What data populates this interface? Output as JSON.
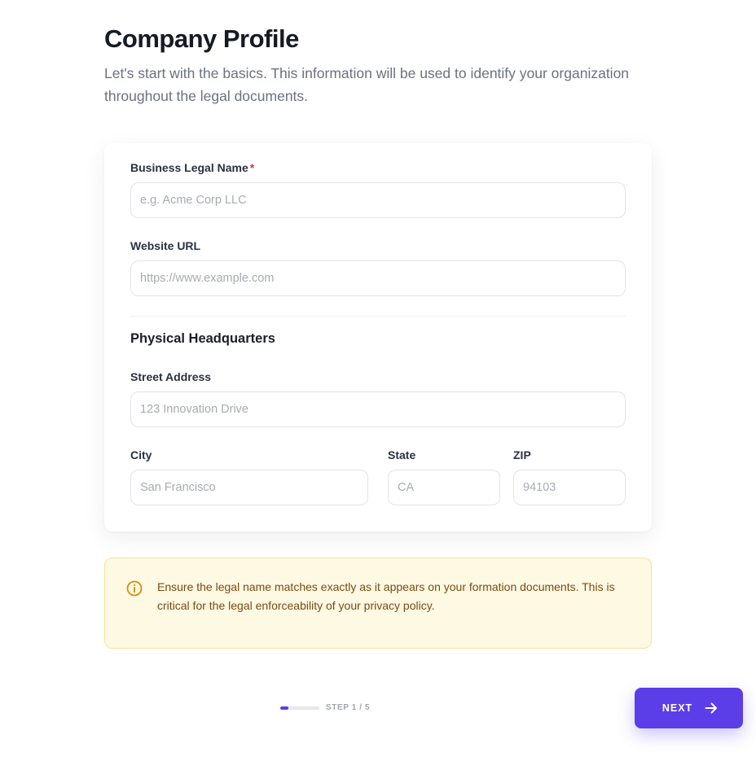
{
  "header": {
    "title": "Company Profile",
    "subtitle": "Let's start with the basics. This information will be used to identify your organization throughout the legal documents."
  },
  "form": {
    "business_name": {
      "label": "Business Legal Name",
      "required_mark": "*",
      "placeholder": "e.g. Acme Corp LLC",
      "value": ""
    },
    "website": {
      "label": "Website URL",
      "placeholder": "https://www.example.com",
      "value": ""
    },
    "hq_section_title": "Physical Headquarters",
    "street": {
      "label": "Street Address",
      "placeholder": "123 Innovation Drive",
      "value": ""
    },
    "city": {
      "label": "City",
      "placeholder": "San Francisco",
      "value": ""
    },
    "state": {
      "label": "State",
      "placeholder": "CA",
      "value": ""
    },
    "zip": {
      "label": "ZIP",
      "placeholder": "94103",
      "value": ""
    }
  },
  "alert": {
    "icon": "info-icon",
    "text": "Ensure the legal name matches exactly as it appears on your formation documents. This is critical for the legal enforceability of your privacy policy."
  },
  "footer": {
    "step_label": "STEP 1 / 5",
    "current_step": 1,
    "total_steps": 5,
    "progress_fraction": 0.2,
    "next_label": "NEXT",
    "next_icon": "arrow-right-icon"
  },
  "colors": {
    "accent": "#5b3ee8",
    "required": "#e0303d",
    "alert_bg": "#fef9e3",
    "alert_border": "#f6e29c",
    "alert_text": "#7a4a12",
    "alert_icon": "#d98a0b"
  }
}
